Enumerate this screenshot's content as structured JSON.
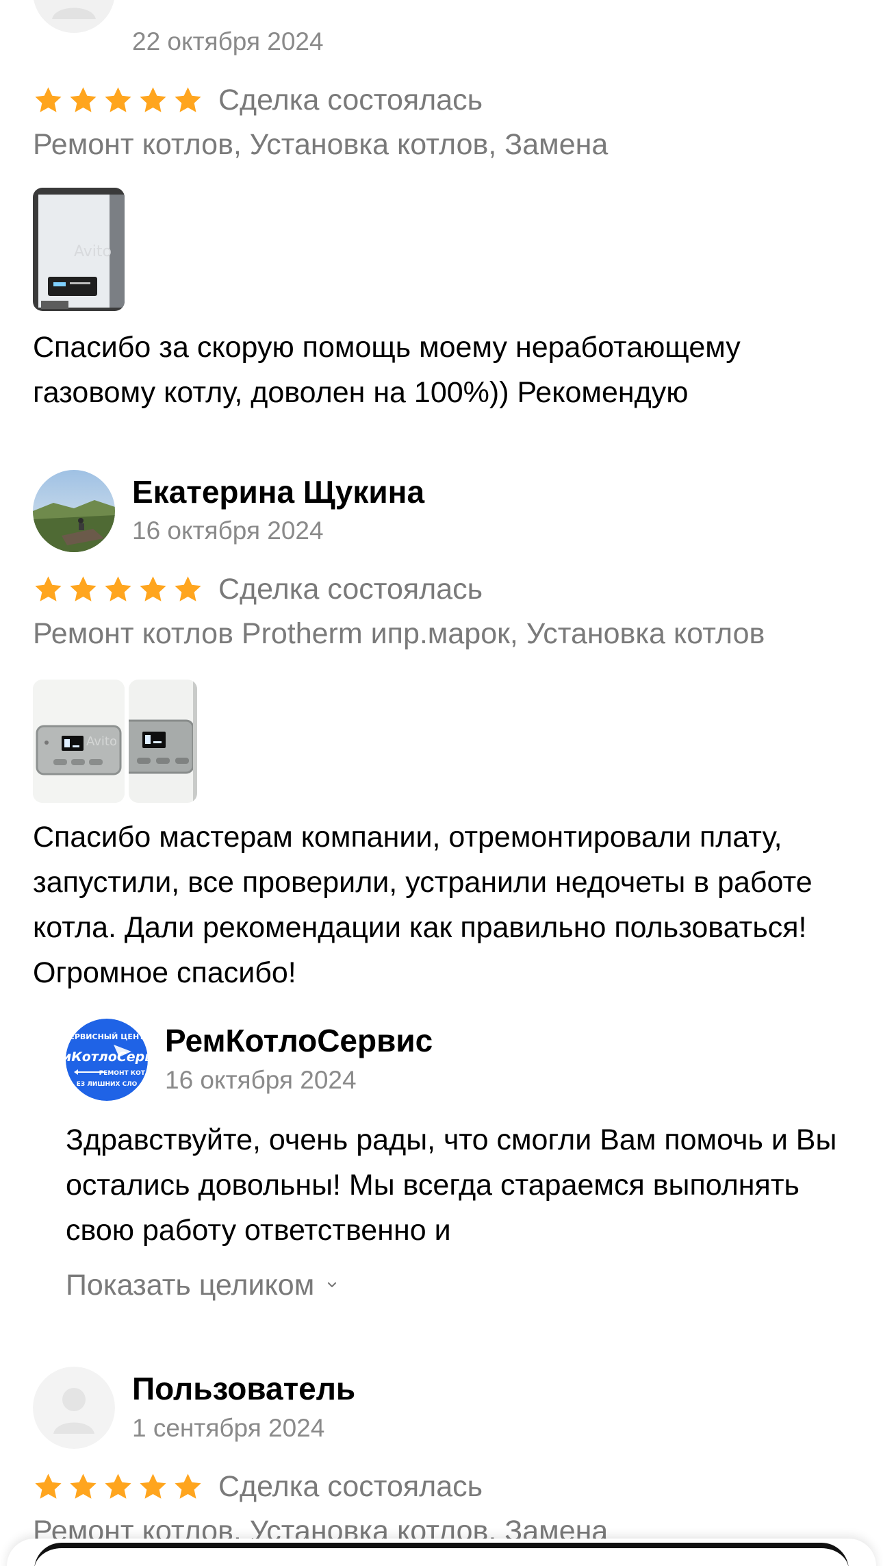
{
  "reviews": [
    {
      "author": "",
      "date": "22 октября 2024",
      "rating": 5,
      "status": "Сделка состоялась",
      "services": "Ремонт котлов, Установка котлов, Замена",
      "photo_count": 1,
      "text": "Спасибо за скорую помощь моему неработающему газовому котлу, доволен на 100%)) Рекомендую"
    },
    {
      "author": "Екатерина Щукина",
      "date": "16 октября 2024",
      "rating": 5,
      "status": "Сделка состоялась",
      "services": "Ремонт котлов Protherm ипр.марок, Установка котлов",
      "photo_count": 2,
      "text": "Спасибо мастерам компании, отремонтировали плату, запустили, все проверили, устранили  недочеты в работе котла. Дали рекомендации как правильно пользоваться! Огромное спасибо!",
      "reply": {
        "author": "РемКотлоСервис",
        "date": "16 октября 2024",
        "text": "Здравствуйте, очень рады, что смогли Вам помочь и Вы остались довольны! Мы всегда стараемся выполнять свою работу ответственно и",
        "show_all": "Показать целиком"
      }
    },
    {
      "author": "Пользователь",
      "date": "1 сентября 2024",
      "rating": 5,
      "status": "Сделка состоялась",
      "services": "Ремонт котлов, Установка котлов, Замена"
    }
  ],
  "brand": {
    "logo_text_top": "ЕРВИСНЫЙ ЦЕНТ",
    "logo_text_main": "мКотлоСерв",
    "logo_text_sub1": "РЕМОНТ КОТЛ",
    "logo_text_sub2": "ЕЗ ЛИШНИХ СЛО"
  },
  "watermark": "Avito",
  "colors": {
    "star": "#FFA51E",
    "muted_text": "#7A7A7A",
    "date_text": "#8A8A8A",
    "logo_blue": "#1F63E6"
  },
  "icons": {
    "star": "star-icon",
    "chevron": "chevron-down-icon",
    "placeholder_user": "user-placeholder-icon"
  }
}
